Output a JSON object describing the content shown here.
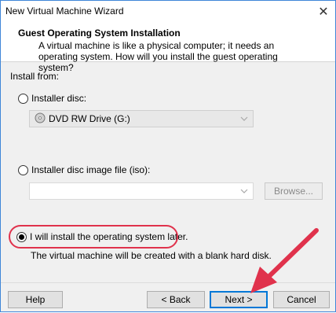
{
  "window": {
    "title": "New Virtual Machine Wizard"
  },
  "header": {
    "title": "Guest Operating System Installation",
    "description": "A virtual machine is like a physical computer; it needs an operating system. How will you install the guest operating system?"
  },
  "install_from": {
    "label": "Install from:",
    "options": [
      {
        "label": "Installer disc:",
        "selected": false
      },
      {
        "label": "Installer disc image file (iso):",
        "selected": false
      },
      {
        "label": "I will install the operating system later.",
        "selected": true
      }
    ],
    "disc_drive": {
      "value": "DVD RW Drive (G:)",
      "icon": "dvd-drive-icon"
    },
    "iso_path": {
      "value": ""
    },
    "browse_label": "Browse...",
    "later_note": "The virtual machine will be created with a blank hard disk."
  },
  "footer": {
    "help_label": "Help",
    "back_label": "< Back",
    "next_label": "Next >",
    "cancel_label": "Cancel"
  },
  "annotation": {
    "highlight_color": "#e0324c",
    "arrow_color": "#e0324c"
  }
}
